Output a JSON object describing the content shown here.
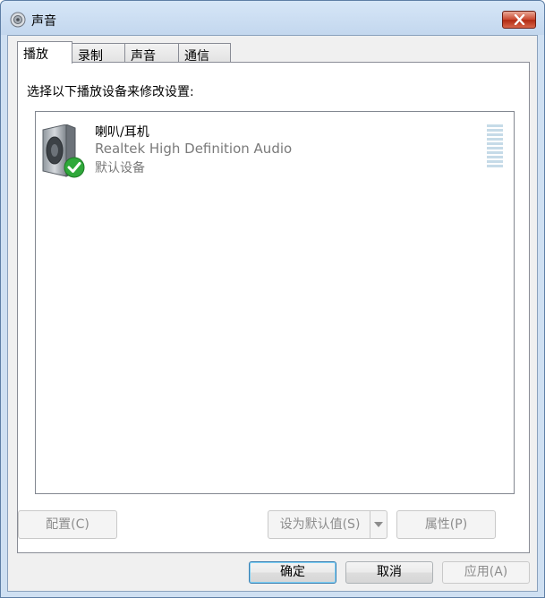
{
  "window": {
    "title": "声音"
  },
  "tabs": [
    {
      "label": "播放",
      "active": true
    },
    {
      "label": "录制",
      "active": false
    },
    {
      "label": "声音",
      "active": false
    },
    {
      "label": "通信",
      "active": false
    }
  ],
  "panel": {
    "instruction": "选择以下播放设备来修改设置:"
  },
  "devices": [
    {
      "name": "喇叭/耳机",
      "description": "Realtek High Definition Audio",
      "status": "默认设备",
      "icon": "speaker-icon",
      "badge_icon": "check-icon"
    }
  ],
  "panel_buttons": {
    "configure": "配置(C)",
    "set_default": "设为默认值(S)",
    "properties": "属性(P)"
  },
  "dialog_buttons": {
    "ok": "确定",
    "cancel": "取消",
    "apply": "应用(A)"
  },
  "colors": {
    "title_bar": "#cfe0f2",
    "close_button": "#c9472e",
    "default_check": "#2fa83a",
    "level_meter": "#c6dbe8"
  }
}
